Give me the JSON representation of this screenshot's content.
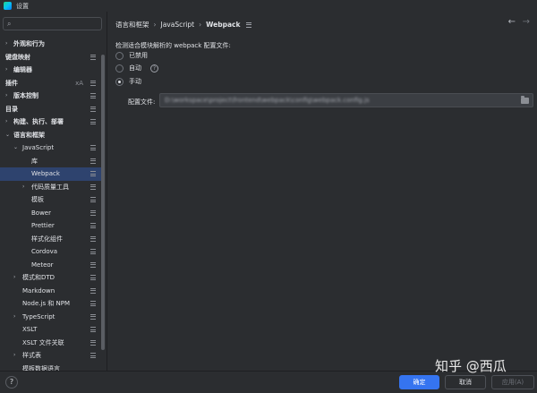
{
  "window": {
    "title": "设置"
  },
  "search": {
    "placeholder": ""
  },
  "sidebar": {
    "items": [
      {
        "label": "外观和行为",
        "bold": true,
        "chevron": "›",
        "indent": 0
      },
      {
        "label": "键盘映射",
        "bold": true,
        "chevron": "",
        "indent": 0
      },
      {
        "label": "编辑器",
        "bold": true,
        "chevron": "›",
        "indent": 0
      },
      {
        "label": "插件",
        "bold": true,
        "chevron": "",
        "indent": 0
      },
      {
        "label": "版本控制",
        "bold": true,
        "chevron": "›",
        "indent": 0
      },
      {
        "label": "目录",
        "bold": true,
        "chevron": "",
        "indent": 0
      },
      {
        "label": "构建、执行、部署",
        "bold": true,
        "chevron": "›",
        "indent": 0
      },
      {
        "label": "语言和框架",
        "bold": true,
        "chevron": "⌄",
        "indent": 0
      },
      {
        "label": "JavaScript",
        "bold": false,
        "chevron": "⌄",
        "indent": 1
      },
      {
        "label": "库",
        "bold": false,
        "chevron": "",
        "indent": 2
      },
      {
        "label": "Webpack",
        "bold": false,
        "chevron": "",
        "indent": 2,
        "selected": true
      },
      {
        "label": "代码质量工具",
        "bold": false,
        "chevron": "›",
        "indent": 2
      },
      {
        "label": "模板",
        "bold": false,
        "chevron": "",
        "indent": 2
      },
      {
        "label": "Bower",
        "bold": false,
        "chevron": "",
        "indent": 2
      },
      {
        "label": "Prettier",
        "bold": false,
        "chevron": "",
        "indent": 2
      },
      {
        "label": "样式化组件",
        "bold": false,
        "chevron": "",
        "indent": 2
      },
      {
        "label": "Cordova",
        "bold": false,
        "chevron": "",
        "indent": 2
      },
      {
        "label": "Meteor",
        "bold": false,
        "chevron": "",
        "indent": 2
      },
      {
        "label": "模式和DTD",
        "bold": false,
        "chevron": "›",
        "indent": 1
      },
      {
        "label": "Markdown",
        "bold": false,
        "chevron": "",
        "indent": 1
      },
      {
        "label": "Node.js 和 NPM",
        "bold": false,
        "chevron": "",
        "indent": 1
      },
      {
        "label": "TypeScript",
        "bold": false,
        "chevron": "›",
        "indent": 1
      },
      {
        "label": "XSLT",
        "bold": false,
        "chevron": "",
        "indent": 1
      },
      {
        "label": "XSLT 文件关联",
        "bold": false,
        "chevron": "",
        "indent": 1
      },
      {
        "label": "样式表",
        "bold": false,
        "chevron": "›",
        "indent": 1
      },
      {
        "label": "模板数据语言",
        "bold": false,
        "chevron": "",
        "indent": 1
      }
    ],
    "icon_rows": [
      1,
      3,
      4,
      5,
      6,
      8,
      9,
      10,
      11,
      12,
      13,
      14,
      15,
      16,
      17,
      18,
      19,
      20,
      21,
      22,
      23,
      24
    ]
  },
  "breadcrumb": {
    "parent": "语言和框架",
    "middle": "JavaScript",
    "current": "Webpack",
    "separator": "›"
  },
  "main": {
    "detect_label": "检测适合模块解析的 webpack 配置文件:",
    "options": [
      {
        "label": "已禁用",
        "checked": false
      },
      {
        "label": "自动",
        "checked": false,
        "help": true
      },
      {
        "label": "手动",
        "checked": true
      }
    ],
    "config_label": "配置文件:",
    "config_value": "D:\\workspace\\project\\frontend\\webpack\\config\\webpack.config.js"
  },
  "footer": {
    "help": "?",
    "ok": "确定",
    "cancel": "取消",
    "apply": "应用(A)"
  },
  "watermark": "知乎 @西瓜",
  "colors": {
    "accent": "#3574f0",
    "selected_row": "#2e436e",
    "background": "#2b2d30"
  }
}
